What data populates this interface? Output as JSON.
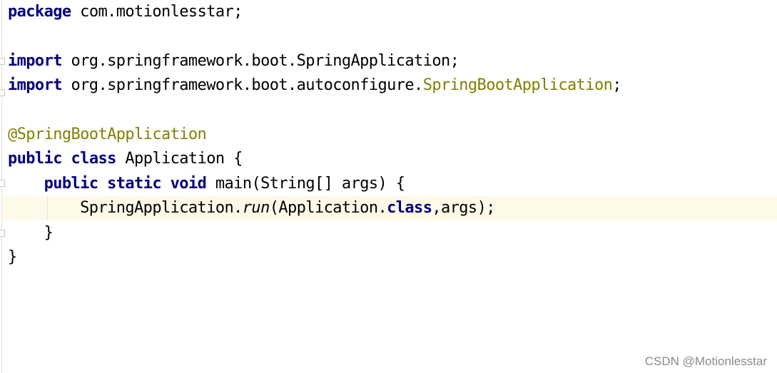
{
  "editor": {
    "lines": [
      {
        "segments": [
          {
            "cls": "kw",
            "text": "package"
          },
          {
            "cls": "",
            "text": " com.motionlesstar;"
          }
        ]
      },
      {
        "segments": []
      },
      {
        "segments": [
          {
            "cls": "kw",
            "text": "import"
          },
          {
            "cls": "",
            "text": " org.springframework.boot.SpringApplication;"
          }
        ]
      },
      {
        "segments": [
          {
            "cls": "kw",
            "text": "import"
          },
          {
            "cls": "",
            "text": " org.springframework.boot.autoconfigure."
          },
          {
            "cls": "ann",
            "text": "SpringBootApplication"
          },
          {
            "cls": "",
            "text": ";"
          }
        ]
      },
      {
        "segments": []
      },
      {
        "segments": [
          {
            "cls": "ann",
            "text": "@SpringBootApplication"
          }
        ]
      },
      {
        "segments": [
          {
            "cls": "kw",
            "text": "public"
          },
          {
            "cls": "",
            "text": " "
          },
          {
            "cls": "kw",
            "text": "class"
          },
          {
            "cls": "",
            "text": " Application {"
          }
        ]
      },
      {
        "segments": [
          {
            "cls": "",
            "text": "    "
          },
          {
            "cls": "kw",
            "text": "public"
          },
          {
            "cls": "",
            "text": " "
          },
          {
            "cls": "kw",
            "text": "static"
          },
          {
            "cls": "",
            "text": " "
          },
          {
            "cls": "kw",
            "text": "void"
          },
          {
            "cls": "",
            "text": " main(String[] args) {"
          }
        ]
      },
      {
        "segments": [
          {
            "cls": "",
            "text": "        SpringApplication."
          },
          {
            "cls": "it",
            "text": "run"
          },
          {
            "cls": "",
            "text": "(Application."
          },
          {
            "cls": "kw",
            "text": "class"
          },
          {
            "cls": "",
            "text": ",args);"
          }
        ]
      },
      {
        "segments": [
          {
            "cls": "",
            "text": "    }"
          }
        ]
      },
      {
        "segments": [
          {
            "cls": "",
            "text": "}"
          }
        ]
      }
    ]
  },
  "watermark": "CSDN @Motionlesstar",
  "colors": {
    "keyword": "#000080",
    "annotation": "#808000",
    "caret_row": "#fdfae8"
  }
}
